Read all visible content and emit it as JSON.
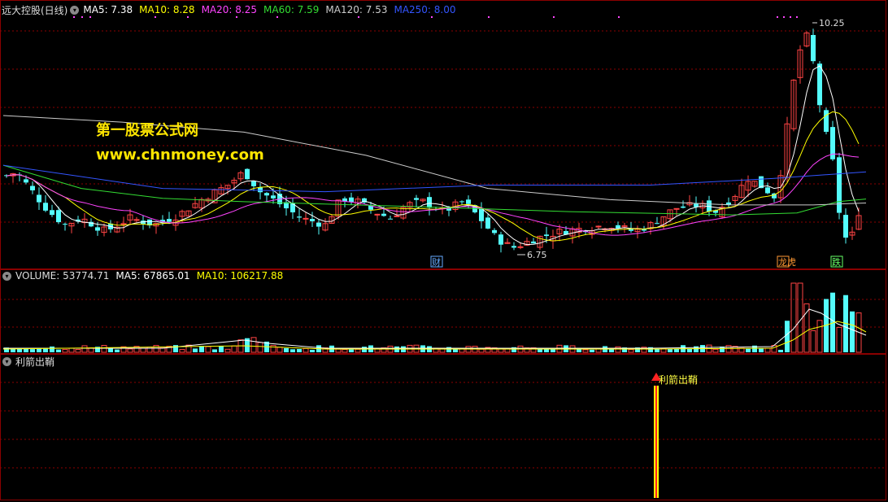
{
  "main": {
    "title": "远大控股(日线)",
    "ma_items": [
      {
        "label": "MA5: 7.38",
        "color": "#ffffff"
      },
      {
        "label": "MA10: 8.28",
        "color": "#ffff00"
      },
      {
        "label": "MA20: 8.25",
        "color": "#ff44ff"
      },
      {
        "label": "MA60: 7.59",
        "color": "#33dd33"
      },
      {
        "label": "MA120: 7.53",
        "color": "#cccccc"
      },
      {
        "label": "MA250: 8.00",
        "color": "#3355ff"
      }
    ],
    "watermark_line1": "第一股票公式网",
    "watermark_line2": "www.chnmoney.com",
    "high_label": "10.25",
    "low_label": "6.75",
    "badge_cai": "财",
    "badge_longhu": "龙虎",
    "badge_die": "跌"
  },
  "volume": {
    "items": [
      {
        "label": "VOLUME: 53774.71",
        "color": "#dddddd"
      },
      {
        "label": "MA5: 67865.01",
        "color": "#ffffff"
      },
      {
        "label": "MA10: 106217.88",
        "color": "#ffff00"
      }
    ]
  },
  "signal": {
    "title": "利箭出鞘",
    "marker_label": "利箭出鞘"
  },
  "colors": {
    "up": "#ff4444",
    "down": "#54fcfc",
    "grid": "#8b0000"
  },
  "chart_data": {
    "type": "candlestick",
    "price_high": 10.25,
    "price_low": 6.75,
    "ma_last": {
      "MA5": 7.38,
      "MA10": 8.28,
      "MA20": 8.25,
      "MA60": 7.59,
      "MA120": 7.53,
      "MA250": 8.0
    },
    "volume_last": 53774.71,
    "volume_ma5": 67865.01,
    "volume_ma10": 106217.88
  }
}
